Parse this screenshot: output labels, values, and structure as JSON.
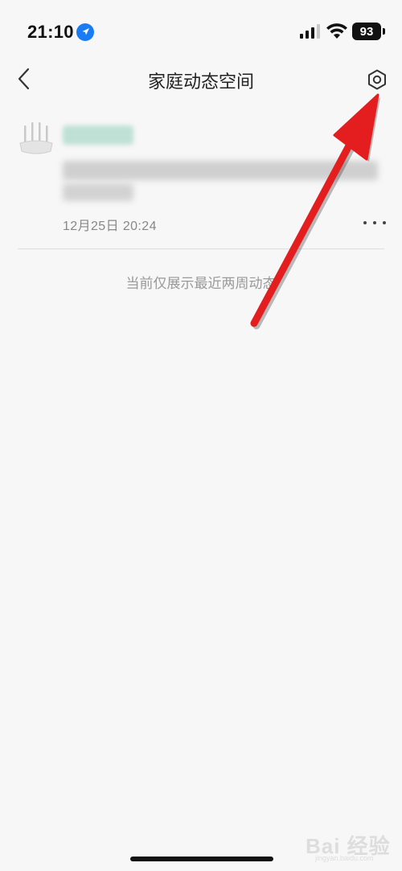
{
  "status_bar": {
    "time": "21:10",
    "battery": "93"
  },
  "header": {
    "title": "家庭动态空间"
  },
  "feed": {
    "items": [
      {
        "timestamp": "12月25日 20:24"
      }
    ]
  },
  "footer_note": "当前仅展示最近两周动态",
  "watermark": {
    "text": "Bai 经验",
    "sub": "jingyan.baidu.com"
  },
  "colors": {
    "background": "#f7f7f7",
    "arrow": "#e41e1e",
    "location_blue": "#1a7cf5",
    "blur_green": "#bfe0d4"
  },
  "icons": {
    "back": "chevron-left-icon",
    "settings": "hexagon-gear-icon",
    "more": "ellipsis-icon",
    "location": "location-arrow-icon",
    "signal": "cellular-signal-icon",
    "wifi": "wifi-icon",
    "avatar": "router-icon"
  }
}
